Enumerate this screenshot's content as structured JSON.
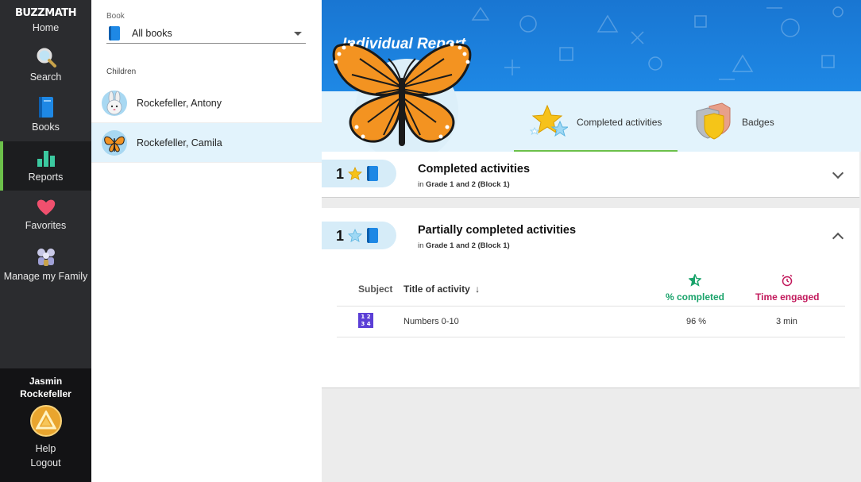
{
  "nav": {
    "logo": "BUZZMATH",
    "items": [
      {
        "label": "Home",
        "icon": "home-icon"
      },
      {
        "label": "Search",
        "icon": "search-icon"
      },
      {
        "label": "Books",
        "icon": "book-icon"
      },
      {
        "label": "Reports",
        "icon": "bar-chart-icon",
        "active": true
      },
      {
        "label": "Favorites",
        "icon": "heart-icon"
      },
      {
        "label": "Manage my Family",
        "icon": "family-icon"
      }
    ],
    "user": {
      "first": "Jasmin",
      "last": "Rockefeller"
    },
    "help": "Help",
    "logout": "Logout"
  },
  "panel": {
    "book_label": "Book",
    "book_value": "All books",
    "children_label": "Children",
    "children": [
      {
        "name": "Rockefeller, Antony",
        "avatar": "bunny-icon",
        "selected": false
      },
      {
        "name": "Rockefeller, Camila",
        "avatar": "butterfly-icon",
        "selected": true
      }
    ]
  },
  "report": {
    "title": "Individual Report",
    "tabs": [
      {
        "label": "Completed activities",
        "active": true
      },
      {
        "label": "Badges",
        "active": false
      }
    ],
    "completed": {
      "count": "1",
      "title": "Completed activities",
      "sub_prefix": "in",
      "sub_block": "Grade 1 and 2 (Block 1)",
      "expanded": false
    },
    "partial": {
      "count": "1",
      "title": "Partially completed activities",
      "sub_prefix": "in",
      "sub_block": "Grade 1 and 2 (Block 1)",
      "expanded": true,
      "columns": {
        "subject": "Subject",
        "title": "Title of activity",
        "sort_arrow": "↓",
        "completed": "% completed",
        "time": "Time engaged"
      },
      "rows": [
        {
          "subject_icon": "numbers-icon",
          "subject_glyph": "1 2 3 4",
          "title": "Numbers 0-10",
          "completed": "96 %",
          "time": "3 min"
        }
      ]
    }
  },
  "colors": {
    "accent_green": "#6cc04a",
    "completed_green": "#1aa36b",
    "time_magenta": "#c2185b",
    "banner_blue": "#1e88e5",
    "light_blue": "#e2f3fc"
  }
}
